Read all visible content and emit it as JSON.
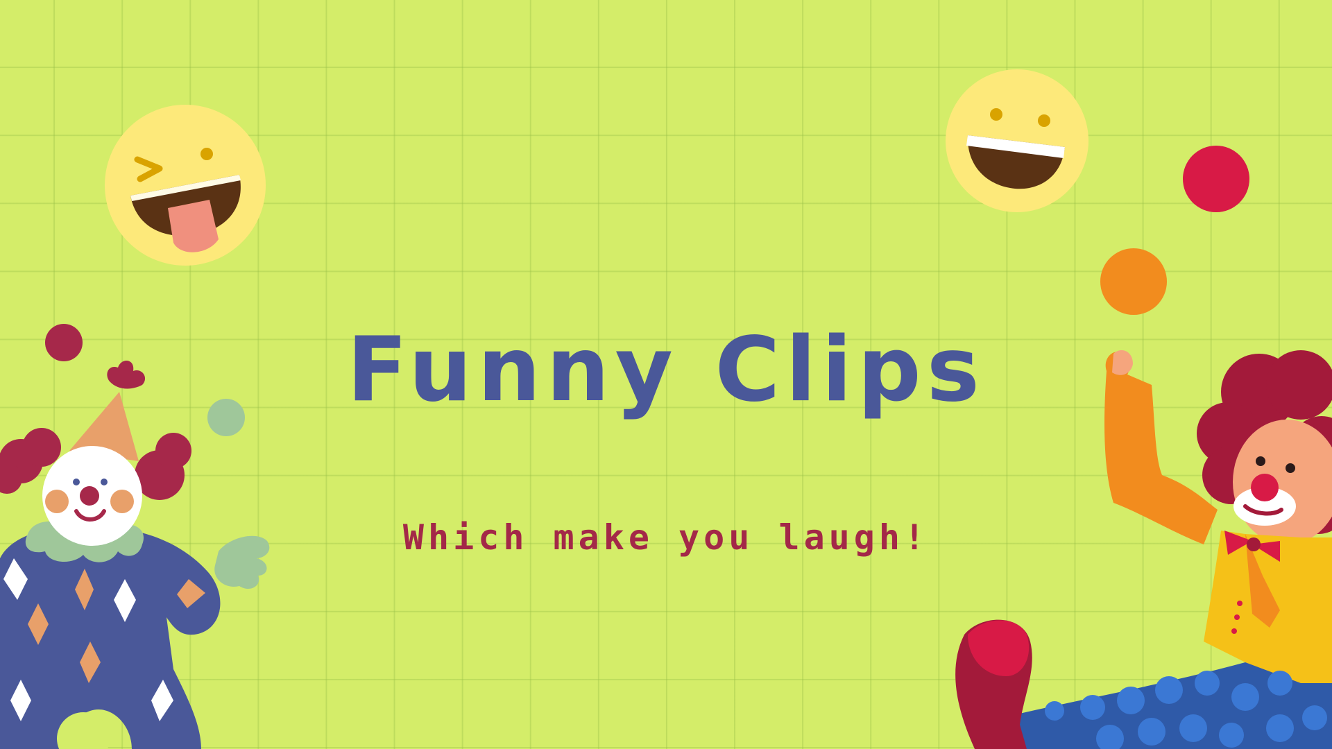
{
  "slide": {
    "title": "Funny Clips",
    "subtitle": "Which make you laugh!"
  },
  "icons": [
    "winking-tongue-emoji-icon",
    "laughing-emoji-icon",
    "juggling-ball-icon",
    "clown-left-illustration",
    "clown-right-illustration"
  ],
  "colors": {
    "background": "#d4ed69",
    "title": "#4a5899",
    "subtitle": "#a32848",
    "emoji": "#fde97a"
  }
}
